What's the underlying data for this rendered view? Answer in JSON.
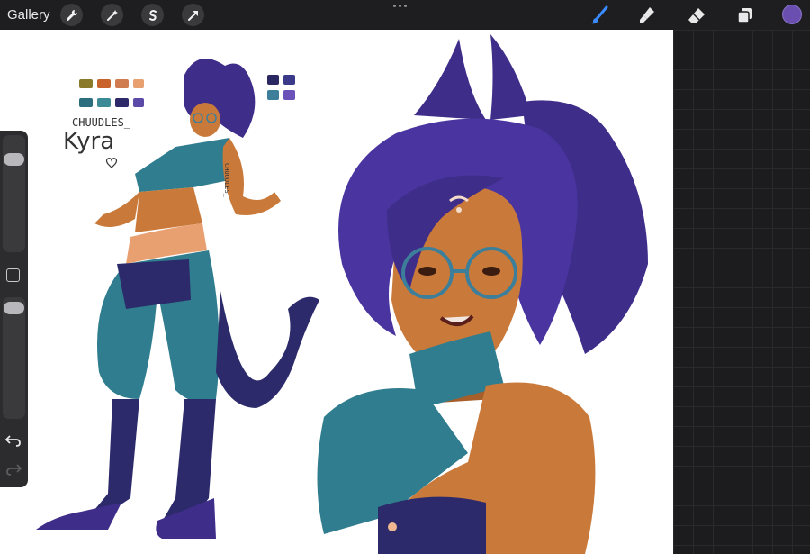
{
  "topbar": {
    "gallery_label": "Gallery",
    "left_tools": [
      "wrench-icon",
      "magic-wand-icon",
      "selection-s-icon",
      "transform-arrow-icon"
    ],
    "right_tools": [
      "brush-icon",
      "smudge-icon",
      "eraser-icon",
      "layers-icon"
    ],
    "active_tool": "brush-icon",
    "active_color": "#6b4fb0"
  },
  "artwork": {
    "signature": "CHUUDLES_",
    "character_name": "Kyra",
    "sleeve_text": "CHUUDLES_",
    "palette_swatches": [
      "#8a7a2a",
      "#c8622a",
      "#d07c50",
      "#e8a070",
      "#2c6e7e",
      "#3b8a96",
      "#2e2a6a",
      "#5b4aa8"
    ],
    "palette_swatches_2": [
      "#2a2860",
      "#3b3a8a",
      "#3d7f9a",
      "#6a52b8"
    ]
  },
  "sidebar": {
    "brush_size_level": 0.9,
    "opacity_level": 0.9
  },
  "colors": {
    "skin": "#c97a3a",
    "hair": "#3f2d8a",
    "teal": "#2f7d8e",
    "navy": "#2c2a6a",
    "accent_peach": "#f0b890"
  }
}
